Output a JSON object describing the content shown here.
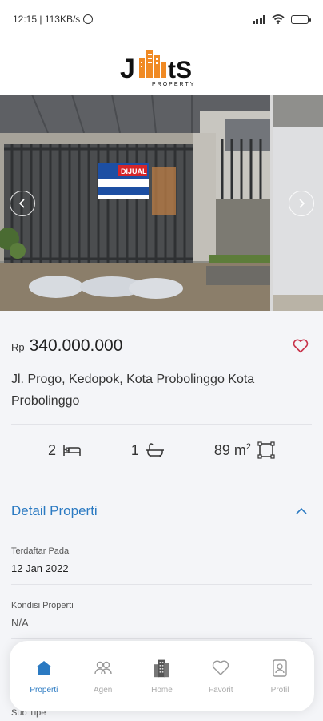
{
  "status_bar": {
    "time_speed": "12:15 | 113KB/s",
    "battery_level": 0.45
  },
  "header": {
    "logo_text": "J  tS",
    "logo_sub": "PROPERTY"
  },
  "listing": {
    "currency": "Rp",
    "price": "340.000.000",
    "address": "Jl. Progo, Kedopok, Kota Probolinggo Kota Probolinggo",
    "bedrooms": "2",
    "bathrooms": "1",
    "area": "89 m",
    "area_unit_sup": "2",
    "photo_sign_text": "DIJUAL"
  },
  "detail": {
    "title": "Detail Properti",
    "fields": [
      {
        "label": "Terdaftar Pada",
        "value": "12 Jan 2022"
      },
      {
        "label": "Kondisi Properti",
        "value": "N/A"
      },
      {
        "label": "Sub Tipe"
      }
    ]
  },
  "nav": {
    "items": [
      {
        "label": "Properti",
        "icon": "home-icon",
        "active": true
      },
      {
        "label": "Agen",
        "icon": "people-icon",
        "active": false
      },
      {
        "label": "Home",
        "icon": "building-icon",
        "active": false
      },
      {
        "label": "Favorit",
        "icon": "heart-icon",
        "active": false
      },
      {
        "label": "Profil",
        "icon": "profile-card-icon",
        "active": false
      }
    ]
  },
  "colors": {
    "accent": "#2b7ac2",
    "favorite": "#c8334a",
    "logo_orange": "#f08a24"
  }
}
